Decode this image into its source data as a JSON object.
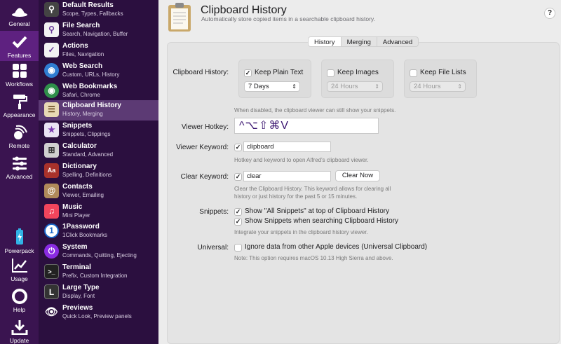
{
  "rail": [
    {
      "label": "General",
      "icon": "alfred-hat-icon"
    },
    {
      "label": "Features",
      "icon": "checkmark-icon"
    },
    {
      "label": "Workflows",
      "icon": "grid-icon"
    },
    {
      "label": "Appearance",
      "icon": "paint-roller-icon"
    },
    {
      "label": "Remote",
      "icon": "remote-icon"
    },
    {
      "label": "Advanced",
      "icon": "sliders-icon"
    },
    {
      "label": "Powerpack",
      "icon": "battery-icon"
    },
    {
      "label": "Usage",
      "icon": "chart-icon"
    },
    {
      "label": "Help",
      "icon": "lifebuoy-icon"
    },
    {
      "label": "Update",
      "icon": "download-icon"
    }
  ],
  "features": [
    {
      "title": "Default Results",
      "subtitle": "Scope, Types, Fallbacks",
      "icon": "magnifier-icon",
      "color": "#444444"
    },
    {
      "title": "File Search",
      "subtitle": "Search, Navigation, Buffer",
      "icon": "document-search-icon",
      "color": "#f2f2f2"
    },
    {
      "title": "Actions",
      "subtitle": "Files, Navigation",
      "icon": "actions-icon",
      "color": "#f2f2f2"
    },
    {
      "title": "Web Search",
      "subtitle": "Custom, URLs, History",
      "icon": "globe-icon",
      "color": "#2f7dd1"
    },
    {
      "title": "Web Bookmarks",
      "subtitle": "Safari, Chrome",
      "icon": "globe-bookmark-icon",
      "color": "#2f8f4a"
    },
    {
      "title": "Clipboard History",
      "subtitle": "History, Merging",
      "icon": "clipboard-icon",
      "color": "#e8d9b5"
    },
    {
      "title": "Snippets",
      "subtitle": "Snippets, Clippings",
      "icon": "star-snippet-icon",
      "color": "#e9e3f3"
    },
    {
      "title": "Calculator",
      "subtitle": "Standard, Advanced",
      "icon": "calculator-icon",
      "color": "#d0d0d0"
    },
    {
      "title": "Dictionary",
      "subtitle": "Spelling, Definitions",
      "icon": "dictionary-icon",
      "color": "#a8322b"
    },
    {
      "title": "Contacts",
      "subtitle": "Viewer, Emailing",
      "icon": "contacts-icon",
      "color": "#b08a5a"
    },
    {
      "title": "Music",
      "subtitle": "Mini Player",
      "icon": "music-icon",
      "color": "#f1455c"
    },
    {
      "title": "1Password",
      "subtitle": "1Click Bookmarks",
      "icon": "1password-icon",
      "color": "#1a66c9"
    },
    {
      "title": "System",
      "subtitle": "Commands, Quitting, Ejecting",
      "icon": "power-icon",
      "color": "#8a2be2"
    },
    {
      "title": "Terminal",
      "subtitle": "Prefix, Custom Integration",
      "icon": "terminal-icon",
      "color": "#222222"
    },
    {
      "title": "Large Type",
      "subtitle": "Display, Font",
      "icon": "large-type-icon",
      "color": "#333333"
    },
    {
      "title": "Previews",
      "subtitle": "Quick Look, Preview panels",
      "icon": "eye-icon",
      "color": "#2b0f3f"
    }
  ],
  "header": {
    "title": "Clipboard History",
    "subtitle": "Automatically store copied items in a searchable clipboard history.",
    "help": "?"
  },
  "tabs": [
    "History",
    "Merging",
    "Advanced"
  ],
  "form": {
    "clipboard_history_label": "Clipboard History:",
    "keep_plain_text": "Keep Plain Text",
    "keep_plain_text_select": "7 Days",
    "keep_images": "Keep Images",
    "keep_images_select": "24 Hours",
    "keep_file_lists": "Keep File Lists",
    "keep_file_lists_select": "24 Hours",
    "disabled_note": "When disabled, the clipboard viewer can still show your snippets.",
    "viewer_hotkey_label": "Viewer Hotkey:",
    "viewer_hotkey_value": "^⌥⇧⌘V",
    "viewer_keyword_label": "Viewer Keyword:",
    "viewer_keyword_value": "clipboard",
    "viewer_keyword_note": "Hotkey and keyword to open Alfred's clipboard viewer.",
    "clear_keyword_label": "Clear Keyword:",
    "clear_keyword_value": "clear",
    "clear_now": "Clear Now",
    "clear_note_1": "Clear the Clipboard History. This keyword allows for clearing all",
    "clear_note_2": "history or just history for the past 5 or 15 minutes.",
    "snippets_label": "Snippets:",
    "snippets_opt1": "Show \"All Snippets\" at top of Clipboard History",
    "snippets_opt2": "Show Snippets when searching Clipboard History",
    "snippets_note": "Integrate your snippets in the clipboard history viewer.",
    "universal_label": "Universal:",
    "universal_opt": "Ignore data from other Apple devices (Universal Clipboard)",
    "universal_note": "Note: This option requires macOS 10.13 High Sierra and above."
  },
  "colors": {
    "rail": "#3a1450",
    "feature_list": "#2b0f3f",
    "accent": "#5c3a74"
  }
}
